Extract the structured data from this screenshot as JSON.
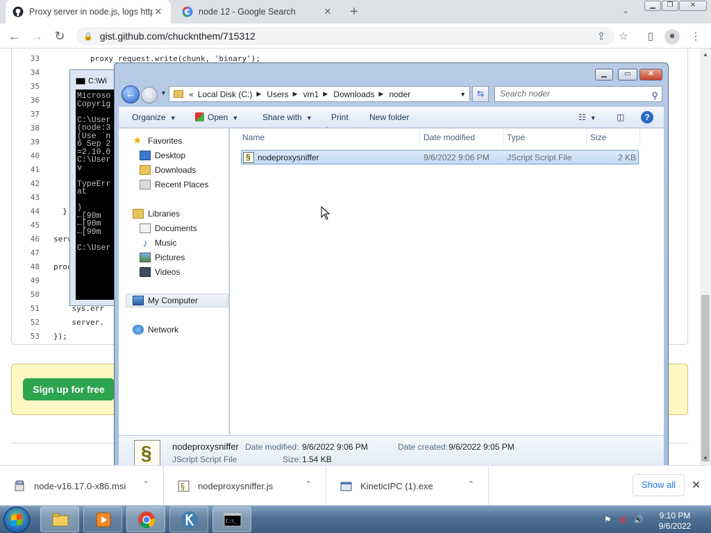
{
  "browser": {
    "tabs": [
      {
        "title": "Proxy server in node.js, logs http",
        "icon": "github-icon",
        "active": true
      },
      {
        "title": "node 12 - Google Search",
        "icon": "google-icon",
        "active": false
      }
    ],
    "url": "gist.github.com/chucknthem/715312"
  },
  "gist": {
    "lines": [
      {
        "n": "33",
        "code": "        proxy_request.write(chunk, 'binary');"
      },
      {
        "n": "34",
        "code": ""
      },
      {
        "n": "35",
        "code": ""
      },
      {
        "n": "36",
        "code": ""
      },
      {
        "n": "37",
        "code": ""
      },
      {
        "n": "38",
        "code": ""
      },
      {
        "n": "39",
        "code": ""
      },
      {
        "n": "40",
        "code": ""
      },
      {
        "n": "41",
        "code": ""
      },
      {
        "n": "42",
        "code": ""
      },
      {
        "n": "43",
        "code": ""
      },
      {
        "n": "44",
        "code": "  }"
      },
      {
        "n": "45",
        "code": ""
      },
      {
        "n": "46",
        "code": "serv"
      },
      {
        "n": "47",
        "code": ""
      },
      {
        "n": "48",
        "code": "proc"
      },
      {
        "n": "49",
        "code": ""
      },
      {
        "n": "50",
        "code": ""
      },
      {
        "n": "51",
        "code": "    sys.err"
      },
      {
        "n": "52",
        "code": "    server."
      },
      {
        "n": "53",
        "code": "});"
      }
    ],
    "signup_label": "Sign up for free"
  },
  "console": {
    "title": "C:\\Wi",
    "lines": [
      "Microso",
      "Copyrig",
      "",
      "C:\\User",
      "(node:3",
      "(Use `n",
      "6 Sep 2",
      "=2.10.0",
      "C:\\User",
      "      v",
      "",
      "TypeErr",
      "    at",
      "",
      ")",
      "←[90m",
      "←[90m",
      "←[90m",
      "",
      "C:\\User"
    ]
  },
  "explorer": {
    "breadcrumbs": [
      "Local Disk (C:)",
      "Users",
      "vm1",
      "Downloads",
      "noder"
    ],
    "breadcrumb_overflow": "«",
    "search_placeholder": "Search noder",
    "commands": {
      "organize": "Organize",
      "open": "Open",
      "share_with": "Share with",
      "print": "Print",
      "new_folder": "New folder"
    },
    "nav": {
      "favorites": "Favorites",
      "favorites_items": [
        "Desktop",
        "Downloads",
        "Recent Places"
      ],
      "libraries": "Libraries",
      "libraries_items": [
        "Documents",
        "Music",
        "Pictures",
        "Videos"
      ],
      "computer": "My Computer",
      "network": "Network"
    },
    "columns": {
      "name": "Name",
      "date": "Date modified",
      "type": "Type",
      "size": "Size"
    },
    "files": [
      {
        "name": "nodeproxysniffer",
        "date": "9/6/2022 9:06 PM",
        "type": "JScript Script File",
        "size": "2 KB"
      }
    ],
    "details": {
      "name": "nodeproxysniffer",
      "type": "JScript Script File",
      "date_modified_label": "Date modified:",
      "date_modified": "9/6/2022 9:06 PM",
      "date_created_label": "Date created:",
      "date_created": "9/6/2022 9:05 PM",
      "size_label": "Size:",
      "size": "1.54 KB"
    }
  },
  "downloads": {
    "items": [
      "node-v16.17.0-x86.msi",
      "nodeproxysniffer.js",
      "KineticIPC (1).exe"
    ],
    "show_all": "Show all"
  },
  "taskbar": {
    "time": "9:10 PM",
    "date": "9/6/2022"
  },
  "colors": {
    "signup_green": "#2da44e",
    "signup_banner": "#fff8c5",
    "chrome_accent": "#1a73e8",
    "explorer_frame": "#a5bddd"
  }
}
